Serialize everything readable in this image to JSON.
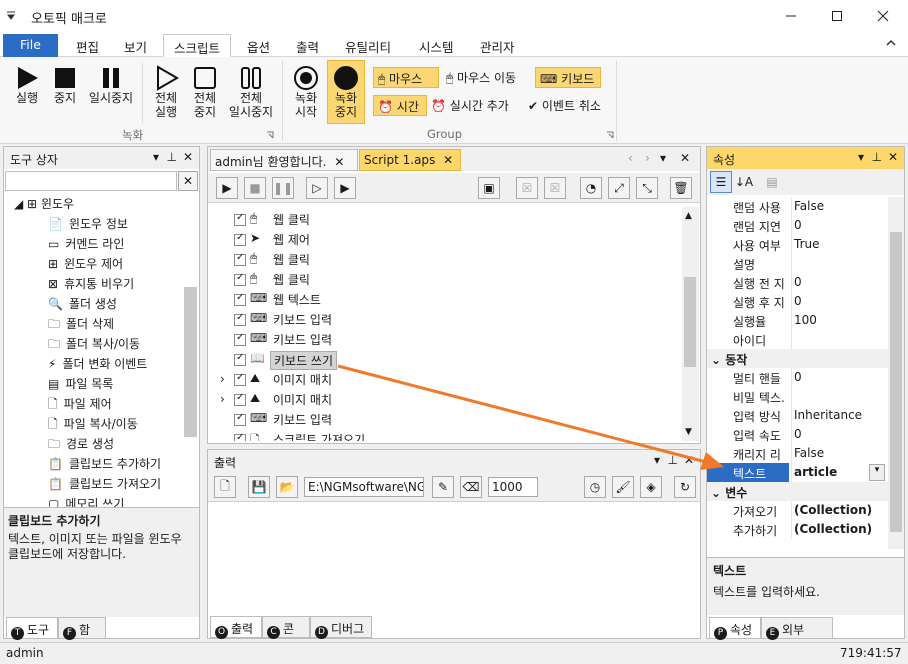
{
  "title": "오토픽 매크로",
  "menu": {
    "file": "File",
    "items": [
      "편집",
      "보기",
      "스크립트",
      "옵션",
      "출력",
      "유틸리티",
      "시스템",
      "관리자"
    ]
  },
  "ribbon": {
    "run": "실행",
    "stop": "중지",
    "pause": "일시중지",
    "all_run": "전체\n실행",
    "all_stop": "전체\n중지",
    "all_pause": "전체\n일시중지",
    "rec_start": "녹화\n시작",
    "rec_stop": "녹화\n중지",
    "group1": "녹화",
    "group2": "Group",
    "mouse": "마우스",
    "mouse_move": "마우스 이동",
    "keyboard": "키보드",
    "time": "시간",
    "realtime_add": "실시간 추가",
    "event_cancel": "이벤트 취소"
  },
  "toolbox": {
    "title": "도구 상자",
    "category": "윈도우",
    "items": [
      "윈도우 정보",
      "커멘드 라인",
      "윈도우 제어",
      "휴지통 비우기",
      "폴더 생성",
      "폴더 삭제",
      "폴더 복사/이동",
      "폴더 변화 이벤트",
      "파일 목록",
      "파일 제어",
      "파일 복사/이동",
      "경로 생성",
      "클립보드 추가하기",
      "클립보드 가져오기",
      "메모리 쓰기"
    ],
    "desc_title": "클립보드 추가하기",
    "desc_text": "텍스트, 이미지 또는 파일을 윈도우 클립보드에 저장합니다.",
    "tab_tools": "도구",
    "tab_funcs": "함수",
    "tab_tools_badge": "T",
    "tab_funcs_badge": "F"
  },
  "script": {
    "tabs": [
      "admin님 환영합니다.",
      "Script 1.aps"
    ],
    "lines": [
      "웹 클릭",
      "웹 제어",
      "웹 클릭",
      "웹 클릭",
      "웹 텍스트",
      "키보드 입력",
      "키보드 입력",
      "키보드 쓰기",
      "이미지 매치",
      "이미지 매치",
      "키보드 입력",
      "스크립트 가져오기"
    ]
  },
  "output": {
    "title": "출력",
    "path": "E:\\NGMsoftware\\NG",
    "number": "1000",
    "tabs": [
      "출력",
      "콘솔",
      "디버그"
    ],
    "tab_badges": [
      "O",
      "C",
      "D"
    ]
  },
  "props": {
    "title": "속성",
    "rows": [
      {
        "k": "랜덤 사용",
        "v": "False"
      },
      {
        "k": "랜덤 지연",
        "v": "0"
      },
      {
        "k": "사용 여부",
        "v": "True"
      },
      {
        "k": "설명",
        "v": ""
      },
      {
        "k": "실행 전 지",
        "v": "0"
      },
      {
        "k": "실행 후 지",
        "v": "0"
      },
      {
        "k": "실행율",
        "v": "100"
      },
      {
        "k": "아이디",
        "v": ""
      }
    ],
    "section_action": "동작",
    "rows2": [
      {
        "k": "멀티 핸들",
        "v": "0"
      },
      {
        "k": "비밀 텍스.",
        "v": ""
      },
      {
        "k": "입력 방식",
        "v": "Inheritance"
      },
      {
        "k": "입력 속도",
        "v": "0"
      },
      {
        "k": "캐리지 리",
        "v": "False"
      }
    ],
    "selected_key": "텍스트",
    "selected_value": "article",
    "section_vars": "변수",
    "rows3": [
      {
        "k": "가져오기",
        "v": "(Collection)"
      },
      {
        "k": "추가하기",
        "v": "(Collection)"
      }
    ],
    "desc_title": "텍스트",
    "desc_text": "텍스트를 입력하세요.",
    "tab_props": "속성",
    "tab_api": "외부 API",
    "tab_props_badge": "P",
    "tab_api_badge": "E"
  },
  "status": {
    "user": "admin",
    "time": "719:41:57"
  },
  "colors": {
    "accent": "#2b6cc4",
    "highlight": "#fdd76a",
    "arrow": "#f0792a"
  }
}
